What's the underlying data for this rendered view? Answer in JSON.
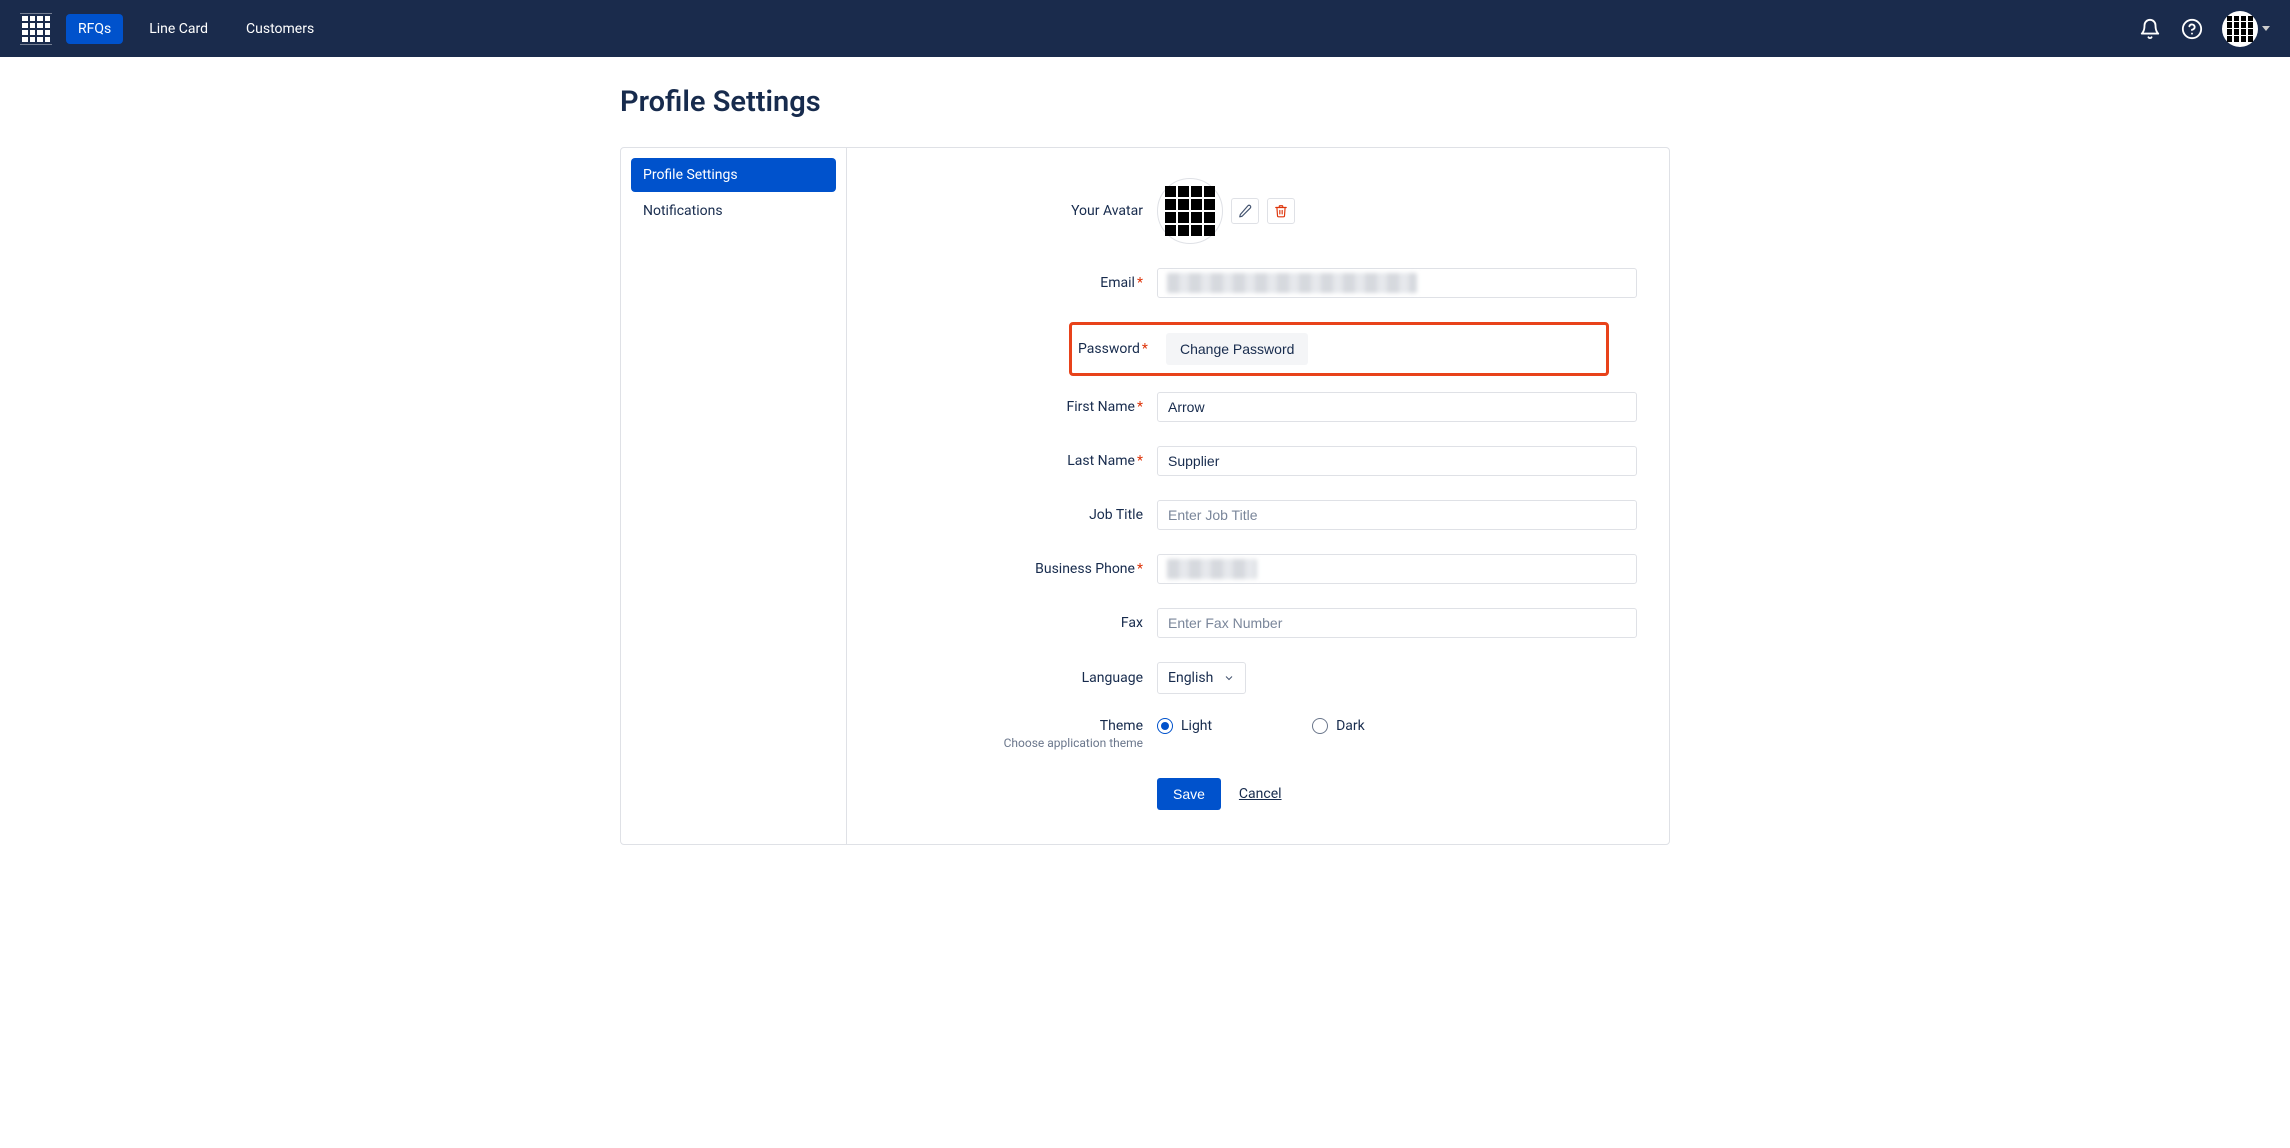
{
  "nav": {
    "rfqs": "RFQs",
    "line_card": "Line Card",
    "customers": "Customers"
  },
  "page": {
    "title": "Profile Settings"
  },
  "sidebar": {
    "profile_settings": "Profile Settings",
    "notifications": "Notifications"
  },
  "form": {
    "avatar_label": "Your Avatar",
    "email_label": "Email",
    "email_value": "",
    "password_label": "Password",
    "change_password_btn": "Change Password",
    "first_name_label": "First Name",
    "first_name_value": "Arrow",
    "last_name_label": "Last Name",
    "last_name_value": "Supplier",
    "job_title_label": "Job Title",
    "job_title_placeholder": "Enter Job Title",
    "job_title_value": "",
    "business_phone_label": "Business Phone",
    "business_phone_value": "",
    "fax_label": "Fax",
    "fax_placeholder": "Enter Fax Number",
    "fax_value": "",
    "language_label": "Language",
    "language_value": "English",
    "theme_label": "Theme",
    "theme_sub": "Choose application theme",
    "theme_light": "Light",
    "theme_dark": "Dark",
    "save_btn": "Save",
    "cancel_btn": "Cancel"
  }
}
